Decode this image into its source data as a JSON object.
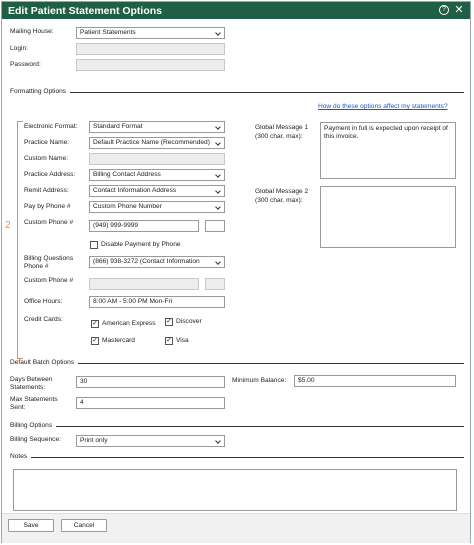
{
  "window": {
    "title": "Edit Patient Statement Options",
    "help_icon": "?",
    "close_icon": "✕"
  },
  "top": {
    "mailing_house_label": "Mailing House:",
    "mailing_house_value": "Patient Statements",
    "login_label": "Login:",
    "password_label": "Password:"
  },
  "formatting": {
    "section_title": "Formatting Options",
    "help_link": "How do these options affect my statements?",
    "electronic_format_label": "Electronic Format:",
    "electronic_format_value": "Standard Format",
    "practice_name_label": "Practice Name:",
    "practice_name_value": "Default Practice Name (Recommended)",
    "custom_name_label": "Custom Name:",
    "practice_address_label": "Practice Address:",
    "practice_address_value": "Billing Contact Address",
    "remit_address_label": "Remit Address:",
    "remit_address_value": "Contact Information Address",
    "pay_by_phone_label": "Pay by Phone #",
    "pay_by_phone_value": "Custom Phone Number",
    "custom_phone_label": "Custom Phone #",
    "custom_phone_value": "(949) 999-9999",
    "disable_payment_label": "Disable Payment by Phone",
    "billing_q_label_1": "Billing Questions",
    "billing_q_label_2": "Phone #",
    "billing_q_value": "(866) 938-3272 (Contact Information",
    "custom_phone2_label": "Custom Phone #",
    "office_hours_label": "Office Hours:",
    "office_hours_value": "8:00 AM - 5:00 PM Mon-Fri",
    "credit_cards_label": "Credit Cards:",
    "cards": {
      "amex": "American Express",
      "discover": "Discover",
      "mastercard": "Mastercard",
      "visa": "Visa"
    },
    "check_mark": "✓",
    "global1_label_1": "Global Message 1",
    "global1_label_2": "(300 char. max):",
    "global1_value": "Payment in full is expected upon receipt of this invoice.",
    "global2_label_1": "Global Message 2",
    "global2_label_2": "(300 char. max):",
    "callout_number": "2"
  },
  "batch": {
    "section_title": "Default Batch Options",
    "days_label_1": "Days Between",
    "days_label_2": "Statements:",
    "days_value": "30",
    "min_balance_label": "Minimum Balance:",
    "min_balance_value": "$5.00",
    "max_label_1": "Max Statements",
    "max_label_2": "Sent:",
    "max_value": "4"
  },
  "billing": {
    "section_title": "Billing Options",
    "sequence_label": "Billing Sequence:",
    "sequence_value": "Print only"
  },
  "notes": {
    "section_title": "Notes"
  },
  "footer": {
    "save_label": "Save",
    "cancel_label": "Cancel"
  },
  "colors": {
    "titlebar": "#1f5f46",
    "callout": "#f08a55",
    "link": "#1a56c4"
  }
}
